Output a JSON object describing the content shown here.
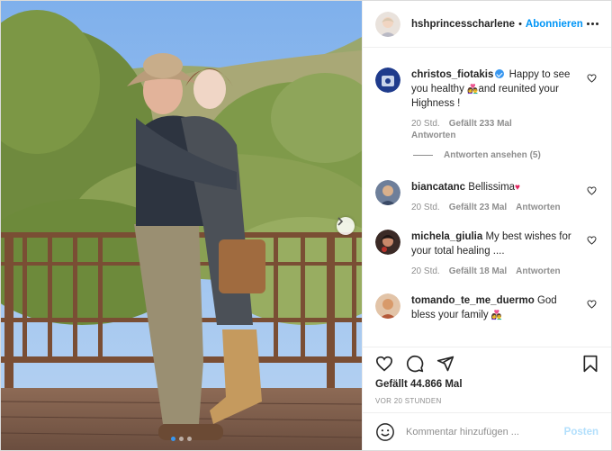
{
  "post": {
    "author": "hshprincesscharlene",
    "follow_label": "Abonnieren",
    "separator": "•"
  },
  "comments": [
    {
      "user": "christos_fiotakis",
      "verified": true,
      "text_a": "Happy to see you healthy ",
      "text_b": "and reunited your Highness !",
      "time": "20 Std.",
      "likes": "Gefällt 233 Mal",
      "reply_label": "Antworten",
      "view_replies": "Antworten ansehen (5)"
    },
    {
      "user": "biancatanc",
      "text_a": "Bellissima",
      "time": "20 Std.",
      "likes": "Gefällt 23 Mal",
      "reply_label": "Antworten"
    },
    {
      "user": "michela_giulia",
      "text_a": "My best wishes for your total healing ....",
      "time": "20 Std.",
      "likes": "Gefällt 18 Mal",
      "reply_label": "Antworten"
    },
    {
      "user": "tomando_te_me_duermo",
      "text_a": "God bless your family",
      "time": "20 Std.",
      "likes": "",
      "reply_label": ""
    }
  ],
  "stats": {
    "likes": "Gefällt 44.866 Mal",
    "timestamp": "VOR 20 STUNDEN"
  },
  "comment_box": {
    "placeholder": "Kommentar hinzufügen ...",
    "post_label": "Posten"
  },
  "colors": {
    "accent": "#0095f6",
    "verified": "#3897f0",
    "muted": "#8e8e8e",
    "post_disabled": "#b2dffc"
  },
  "icons": {
    "like": "heart-icon",
    "comment": "comment-icon",
    "share": "paper-plane-icon",
    "save": "bookmark-icon",
    "emoji": "smiley-icon",
    "more": "more-dots-icon",
    "next": "chevron-right-icon"
  },
  "carousel": {
    "current": 1,
    "total": 3
  }
}
